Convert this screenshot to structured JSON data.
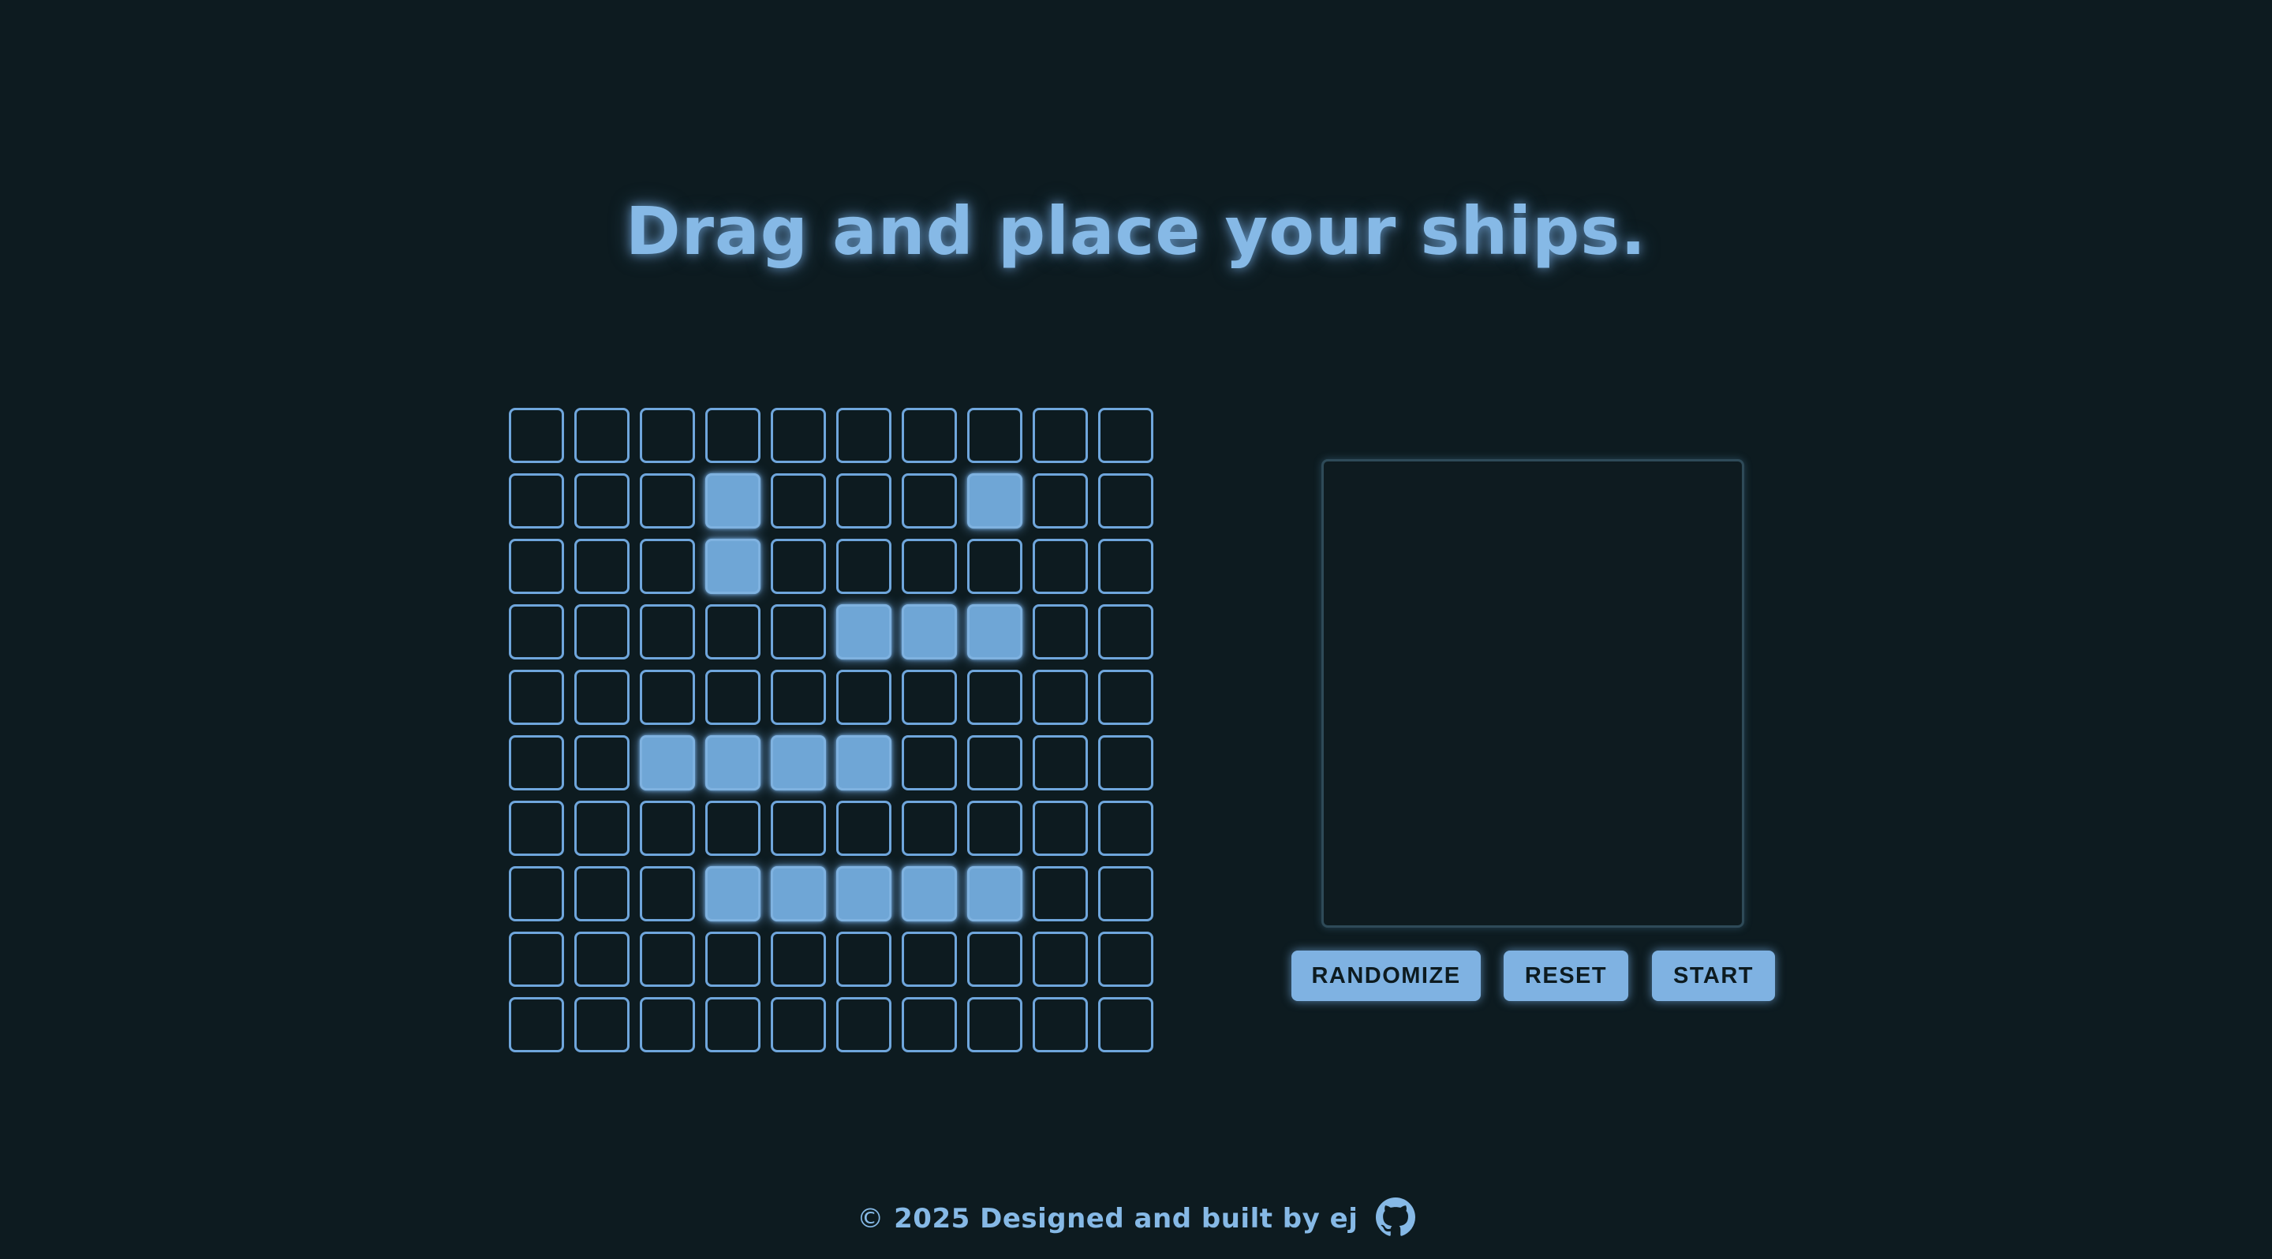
{
  "title": "Drag and place your ships.",
  "board": {
    "rows": 10,
    "cols": 10,
    "ship_cells": [
      [
        1,
        3
      ],
      [
        2,
        3
      ],
      [
        1,
        7
      ],
      [
        3,
        5
      ],
      [
        3,
        6
      ],
      [
        3,
        7
      ],
      [
        5,
        2
      ],
      [
        5,
        3
      ],
      [
        5,
        4
      ],
      [
        5,
        5
      ],
      [
        7,
        3
      ],
      [
        7,
        4
      ],
      [
        7,
        5
      ],
      [
        7,
        6
      ],
      [
        7,
        7
      ]
    ]
  },
  "controls": {
    "randomize_label": "RANDOMIZE",
    "reset_label": "RESET",
    "start_label": "START"
  },
  "footer": {
    "copyright_symbol": "©",
    "text": "2025 Designed and built by ej",
    "icon": "github-icon"
  },
  "colors": {
    "background": "#0d1b20",
    "accent": "#7fb2e2",
    "ship": "#6fa6d6"
  }
}
